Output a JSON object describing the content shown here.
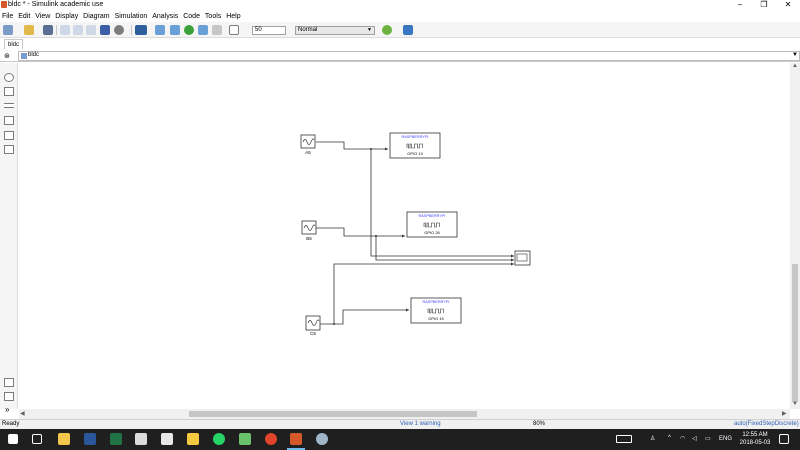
{
  "window": {
    "title": "bldc * - Simulink academic use",
    "minimize": "–",
    "restore": "❐",
    "close": "✕"
  },
  "menu": [
    "File",
    "Edit",
    "View",
    "Display",
    "Diagram",
    "Simulation",
    "Analysis",
    "Code",
    "Tools",
    "Help"
  ],
  "toolbar": {
    "stop_time": "50",
    "sim_mode": "Normal"
  },
  "tab": {
    "label": "bldc"
  },
  "address": {
    "path": "bldc"
  },
  "blocks": {
    "sources": [
      {
        "label": "A5"
      },
      {
        "label": "B5"
      },
      {
        "label": "C5"
      }
    ],
    "gpio": [
      {
        "header": "RASPBERRYPI",
        "port": "GPIO 13"
      },
      {
        "header": "RASPBERRYPI",
        "port": "GPIO 26"
      },
      {
        "header": "RASPBERRYPI",
        "port": "GPIO 19"
      }
    ]
  },
  "status": {
    "left": "Ready",
    "center": "View 1 warning",
    "zoom": "80%",
    "solver": "auto(FixedStepDiscrete)"
  },
  "taskbar": {
    "lang": "ENG",
    "time": "12:55 AM",
    "date": "2018-05-03"
  },
  "colors": {
    "block_header": "#3a3aff",
    "wire": "#000000",
    "taskbar_bg": "#1f1f1f"
  }
}
